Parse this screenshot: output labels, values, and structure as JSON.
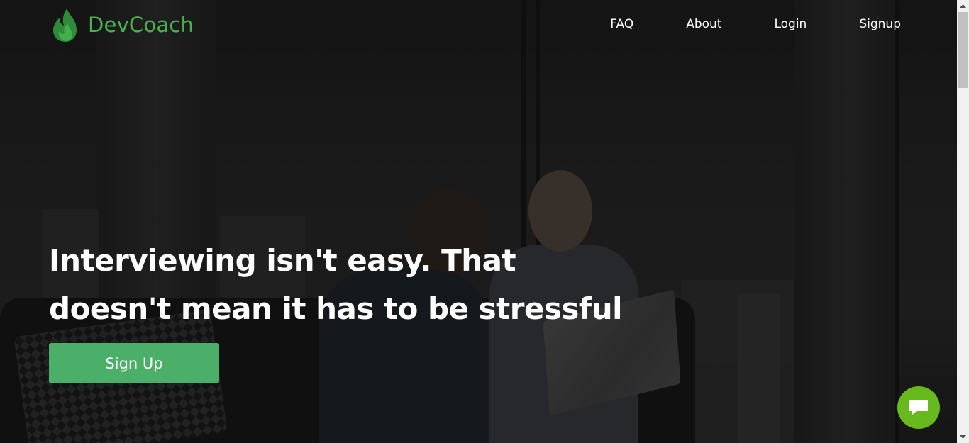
{
  "brand": {
    "name": "DevCoach",
    "color": "#4caf50"
  },
  "nav": {
    "items": [
      {
        "label": "FAQ"
      },
      {
        "label": "About"
      },
      {
        "label": "Login"
      },
      {
        "label": "Signup"
      }
    ]
  },
  "hero": {
    "headline": "Interviewing isn't easy. That doesn't mean it has to be stressful",
    "cta_label": "Sign Up",
    "cta_color": "#4caf69"
  },
  "chat": {
    "icon": "chat-bubble-icon",
    "color": "#67b91d"
  }
}
